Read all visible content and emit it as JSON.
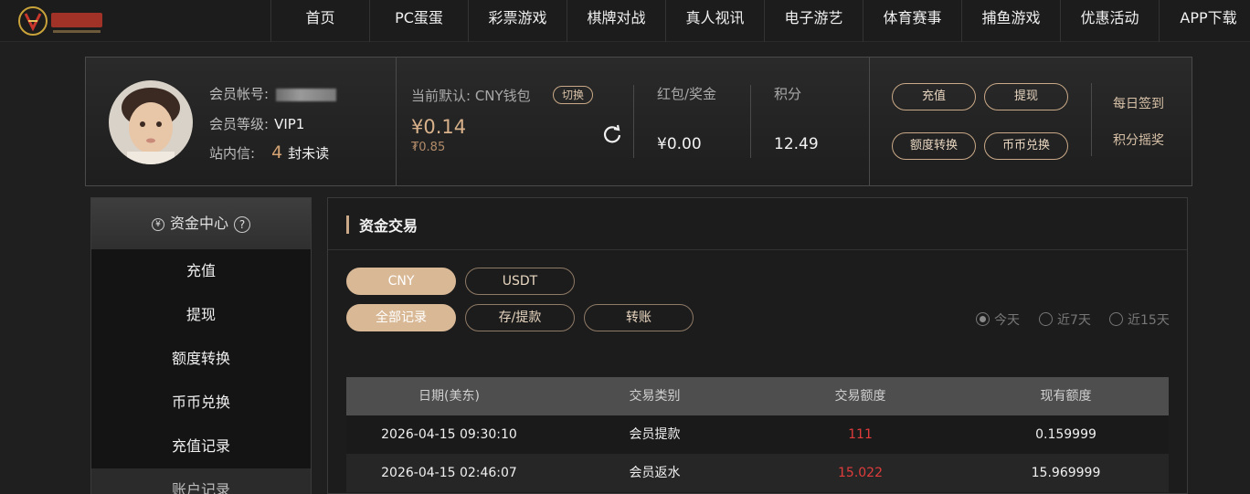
{
  "nav": {
    "items": [
      "首页",
      "PC蛋蛋",
      "彩票游戏",
      "棋牌对战",
      "真人视讯",
      "电子游艺",
      "体育赛事",
      "捕鱼游戏",
      "优惠活动",
      "APP下载"
    ]
  },
  "account": {
    "account_label": "会员帐号:",
    "level_label": "会员等级:",
    "level_value": "VIP1",
    "message_label": "站内信:",
    "message_count": "4",
    "message_suffix": "封未读",
    "wallet_label": "当前默认: CNY钱包",
    "switch_label": "切换",
    "balance": "¥0.14",
    "balance_sub": "₮0.85",
    "redpacket_label": "红包/奖金",
    "redpacket_value": "¥0.00",
    "points_label": "积分",
    "points_value": "12.49",
    "buttons": {
      "deposit": "充值",
      "withdraw": "提现",
      "transfer": "额度转换",
      "exchange": "币币兑换"
    },
    "daily_signin": "每日签到",
    "points_lottery": "积分摇奖"
  },
  "sidebar": {
    "header": "资金中心",
    "coin_icon_char": "¥",
    "help_char": "?",
    "items": [
      "充值",
      "提现",
      "额度转换",
      "币币兑换",
      "充值记录"
    ],
    "next_section": "账户记录"
  },
  "main": {
    "title": "资金交易",
    "currency_tabs": [
      "CNY",
      "USDT"
    ],
    "type_tabs": [
      "全部记录",
      "存/提款",
      "转账"
    ],
    "ranges": [
      "今天",
      "近7天",
      "近15天"
    ],
    "selected_range": "今天",
    "table": {
      "headers": [
        "日期(美东)",
        "交易类别",
        "交易额度",
        "现有额度"
      ],
      "rows": [
        [
          "2026-04-15 09:30:10",
          "会员提款",
          "111",
          "0.159999"
        ],
        [
          "2026-04-15 02:46:07",
          "会员返水",
          "15.022",
          "15.969999"
        ]
      ]
    }
  },
  "colors": {
    "accent": "#d9b896",
    "gold_text": "#d9b28b",
    "amount_red": "#e03c3c"
  }
}
